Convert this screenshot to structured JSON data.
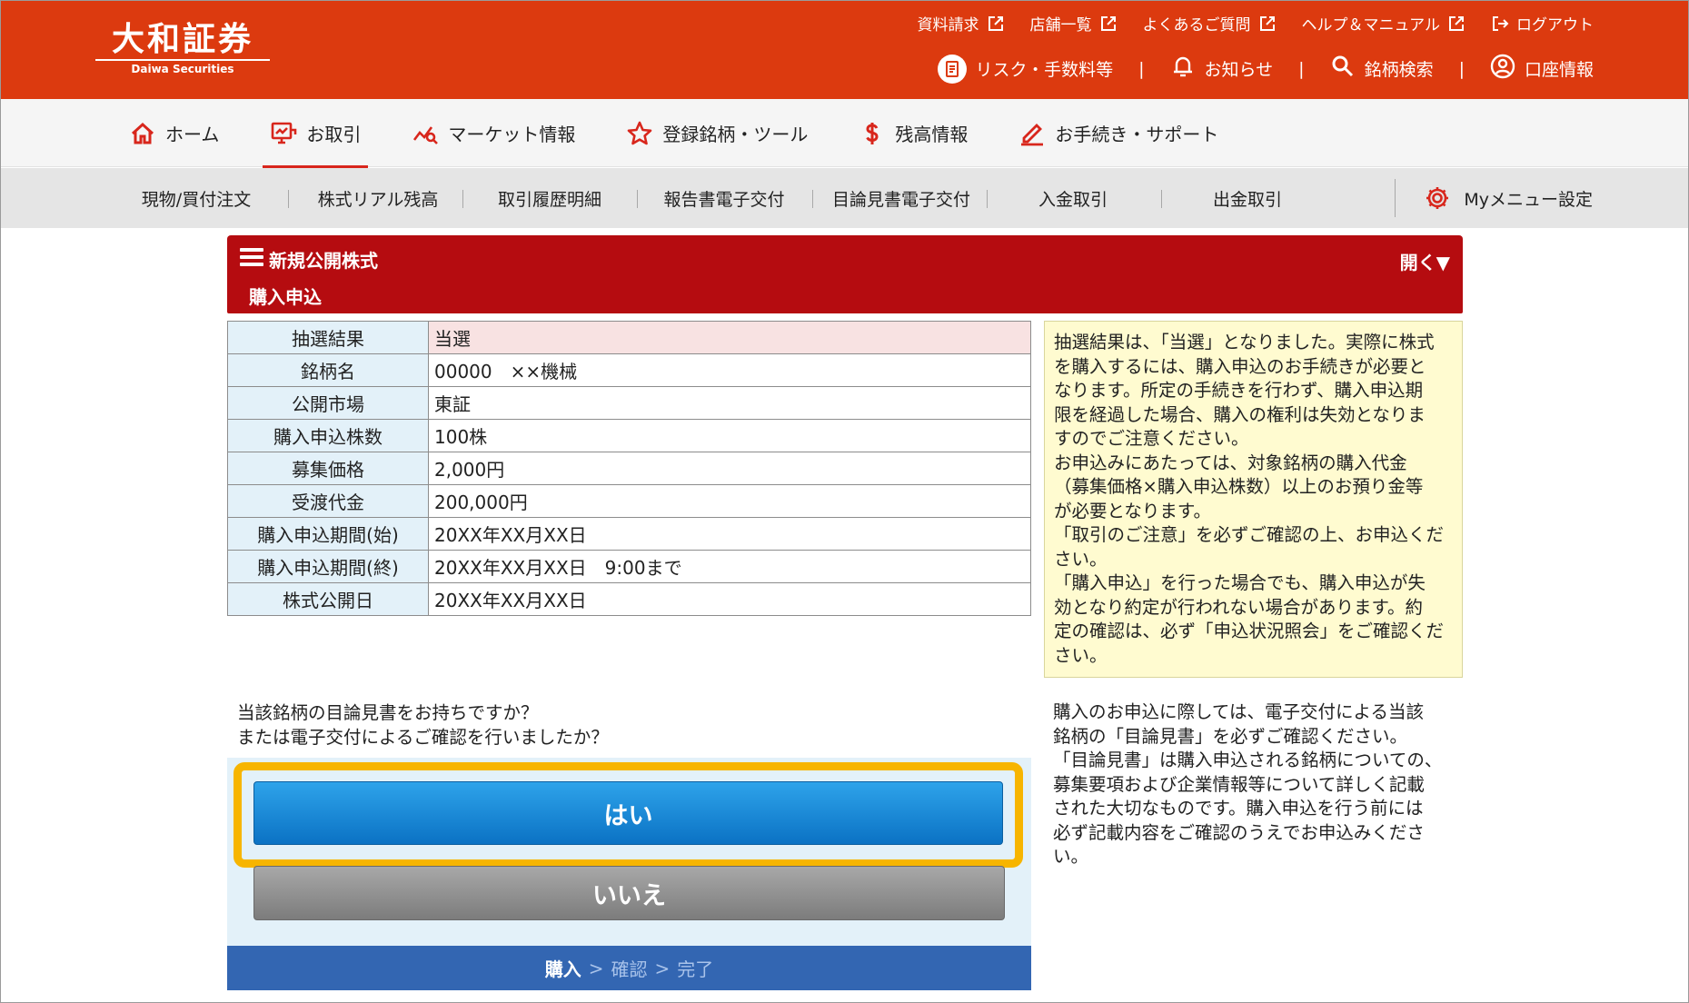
{
  "brand": {
    "name_jp": "大和証券",
    "name_en": "Daiwa Securities"
  },
  "header": {
    "util_links": [
      {
        "label": "資料請求"
      },
      {
        "label": "店舗一覧"
      },
      {
        "label": "よくあるご質問"
      },
      {
        "label": "ヘルプ＆マニュアル"
      },
      {
        "label": "ログアウト"
      }
    ],
    "main_links": [
      {
        "label": "リスク・手数料等"
      },
      {
        "label": "お知らせ"
      },
      {
        "label": "銘柄検索"
      },
      {
        "label": "口座情報"
      }
    ],
    "separator": "|"
  },
  "gnav": [
    {
      "label": "ホーム",
      "icon": "home-icon"
    },
    {
      "label": "お取引",
      "icon": "trade-icon"
    },
    {
      "label": "マーケット情報",
      "icon": "market-icon"
    },
    {
      "label": "登録銘柄・ツール",
      "icon": "star-icon"
    },
    {
      "label": "残高情報",
      "icon": "dollar-icon"
    },
    {
      "label": "お手続き・サポート",
      "icon": "pen-icon"
    }
  ],
  "subnav": {
    "items": [
      {
        "label": "現物/買付注文"
      },
      {
        "label": "株式リアル残高"
      },
      {
        "label": "取引履歴明細"
      },
      {
        "label": "報告書電子交付"
      },
      {
        "label": "目論見書電子交付"
      },
      {
        "label": "入金取引"
      },
      {
        "label": "出金取引"
      }
    ],
    "mymenu": "Myメニュー設定"
  },
  "title_bar": {
    "title": "新規公開株式",
    "subtitle": "購入申込",
    "open_label": "開く▼"
  },
  "detail_rows": [
    {
      "label": "抽選結果",
      "value": "当選"
    },
    {
      "label": "銘柄名",
      "value": "00000　××機械"
    },
    {
      "label": "公開市場",
      "value": "東証"
    },
    {
      "label": "購入申込株数",
      "value": "100株"
    },
    {
      "label": "募集価格",
      "value": "2,000円"
    },
    {
      "label": "受渡代金",
      "value": "200,000円"
    },
    {
      "label": "購入申込期間(始)",
      "value": "20XX年XX月XX日"
    },
    {
      "label": "購入申込期間(終)",
      "value": "20XX年XX月XX日　9:00まで"
    },
    {
      "label": "株式公開日",
      "value": "20XX年XX月XX日"
    }
  ],
  "notice_lines": [
    "抽選結果は、「当選」となりました。実際に株式",
    "を購入するには、購入申込のお手続きが必要と",
    "なります。所定の手続きを行わず、購入申込期",
    "限を経過した場合、購入の権利は失効となりま",
    "すのでご注意ください。",
    "お申込みにあたっては、対象銘柄の購入代金",
    "（募集価格×購入申込株数）以上のお預り金等",
    "が必要となります。",
    "「取引のご注意」を必ずご確認の上、お申込くだ",
    "さい。",
    "「購入申込」を行った場合でも、購入申込が失",
    "効となり約定が行われない場合があります。約",
    "定の確認は、必ず「申込状況照会」をご確認くだ",
    "さい。"
  ],
  "question": {
    "line1": "当該銘柄の目論見書をお持ちですか？",
    "line2": "または電子交付によるご確認を行いましたか？"
  },
  "buttons": {
    "yes": "はい",
    "no": "いいえ"
  },
  "steps": {
    "purchase": "購入",
    "arrow": ">",
    "confirm": "確認",
    "complete": "完了"
  },
  "side_note_lines": [
    "購入のお申込に際しては、電子交付による当該",
    "銘柄の「目論見書」を必ずご確認ください。",
    "「目論見書」は購入申込される銘柄についての、",
    "募集要項および企業情報等について詳しく記載",
    "された大切なものです。購入申込を行う前には",
    "必ず記載内容をご確認のうえでお申込みくださ",
    "い。"
  ],
  "colors": {
    "header_bg": "#dc3a0f",
    "accent_red": "#d8261c",
    "title_bar": "#b50c10",
    "yes_button": "#0b72c4",
    "highlight": "#f7b500",
    "steps_bar": "#3366b2"
  }
}
